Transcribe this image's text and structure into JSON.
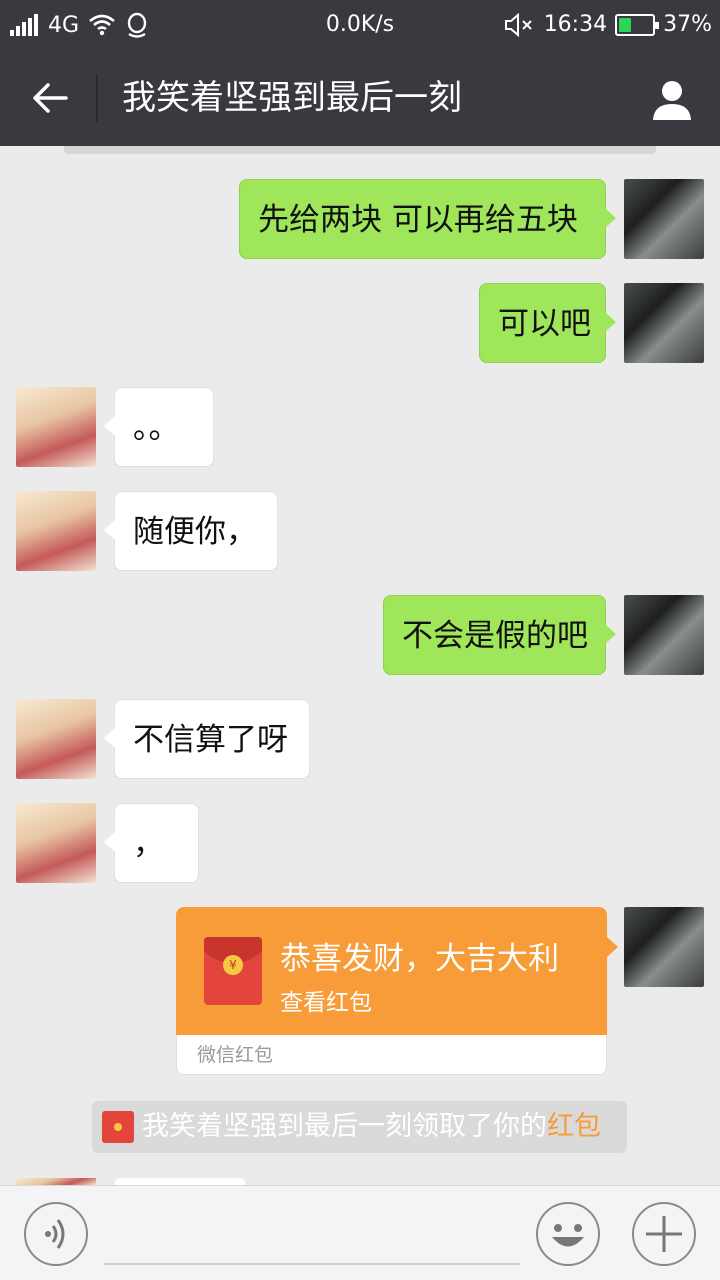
{
  "status_bar": {
    "network": "4G",
    "speed": "0.0K/s",
    "time": "16:34",
    "battery": "37%",
    "battery_level": 0.37,
    "icons": [
      "signal-icon",
      "wifi-icon",
      "qq-icon",
      "mute-icon",
      "battery-icon"
    ]
  },
  "header": {
    "title": "我笑着坚强到最后一刻",
    "back_icon": "back-arrow-icon",
    "profile_icon": "person-icon"
  },
  "messages": [
    {
      "side": "me",
      "text": "先给两块  可以再给五块"
    },
    {
      "side": "me",
      "text": "可以吧"
    },
    {
      "side": "other",
      "text": "。。"
    },
    {
      "side": "other",
      "text": "随便你，"
    },
    {
      "side": "me",
      "text": "不会是假的吧"
    },
    {
      "side": "other",
      "text": "不信算了呀"
    },
    {
      "side": "other",
      "text": "，"
    }
  ],
  "red_packet": {
    "greeting": "恭喜发财，大吉大利",
    "action": "查看红包",
    "footer": "微信红包",
    "color": "#f79c38"
  },
  "system_note": {
    "text": "我笑着坚强到最后一刻领取了你的",
    "link": "红包"
  },
  "input_bar": {
    "icons": [
      "voice-icon",
      "emoji-icon",
      "plus-icon"
    ]
  },
  "colors": {
    "header_bg": "#393a3f",
    "bubble_me": "#9fe65a",
    "bubble_other": "#ffffff",
    "chat_bg": "#ebebeb"
  }
}
